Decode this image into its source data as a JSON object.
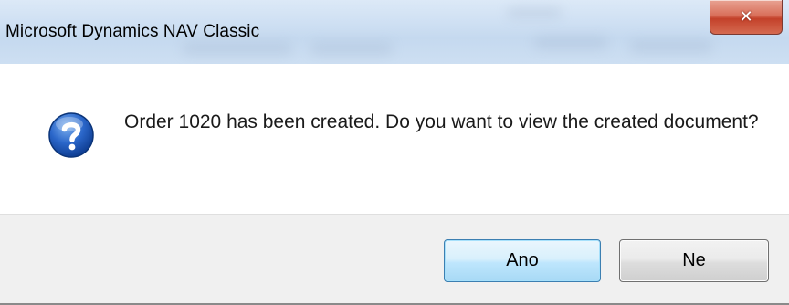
{
  "window": {
    "title": "Microsoft Dynamics NAV Classic",
    "close_glyph": "✕"
  },
  "message": {
    "icon": "question-icon",
    "text": "Order 1020 has been created. Do you want to view the created document?"
  },
  "buttons": {
    "yes_label": "Ano",
    "no_label": "Ne"
  },
  "colors": {
    "titlebar": "#cfe0f3",
    "close_button": "#c3412a",
    "footer": "#f0f0f0",
    "default_button_border": "#3c7fb1",
    "icon_blue": "#1f5fbf"
  }
}
